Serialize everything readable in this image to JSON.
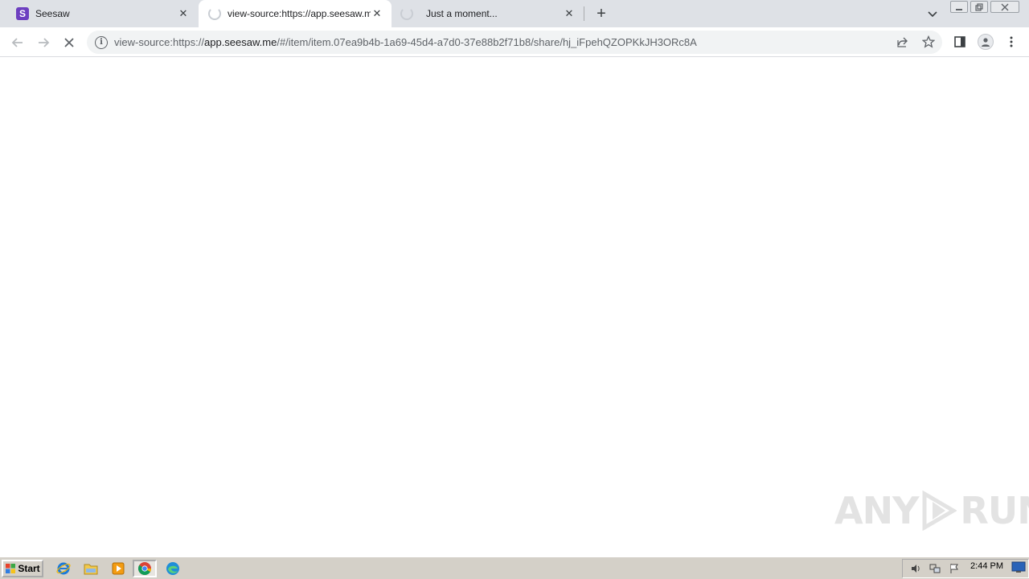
{
  "browser": {
    "tabs": [
      {
        "title": "Seesaw",
        "favicon": "seesaw-logo",
        "favicon_letter": "S",
        "state": "loaded",
        "active": false
      },
      {
        "title": "view-source:https://app.seesaw.me",
        "favicon": "loading-spinner",
        "state": "loading",
        "active": true
      },
      {
        "title": "Just a moment...",
        "favicon": "loading-spinner",
        "state": "loading",
        "active": false
      }
    ],
    "close_glyph": "✕",
    "new_tab_glyph": "+",
    "url": {
      "prefix": "view-source:https://",
      "host": "app.seesaw.me",
      "path": "/#/item/item.07ea9b4b-1a69-45d4-a7d0-37e88b2f71b8/share/hj_iFpehQZOPKkJH3ORc8A"
    }
  },
  "watermark": {
    "left": "ANY",
    "right": "RUN"
  },
  "taskbar": {
    "start_label": "Start",
    "clock": "2:44 PM"
  },
  "colors": {
    "tabstrip": "#dee1e6",
    "seesaw_brand": "#6d3fc0",
    "taskbar": "#d4d0c8"
  }
}
